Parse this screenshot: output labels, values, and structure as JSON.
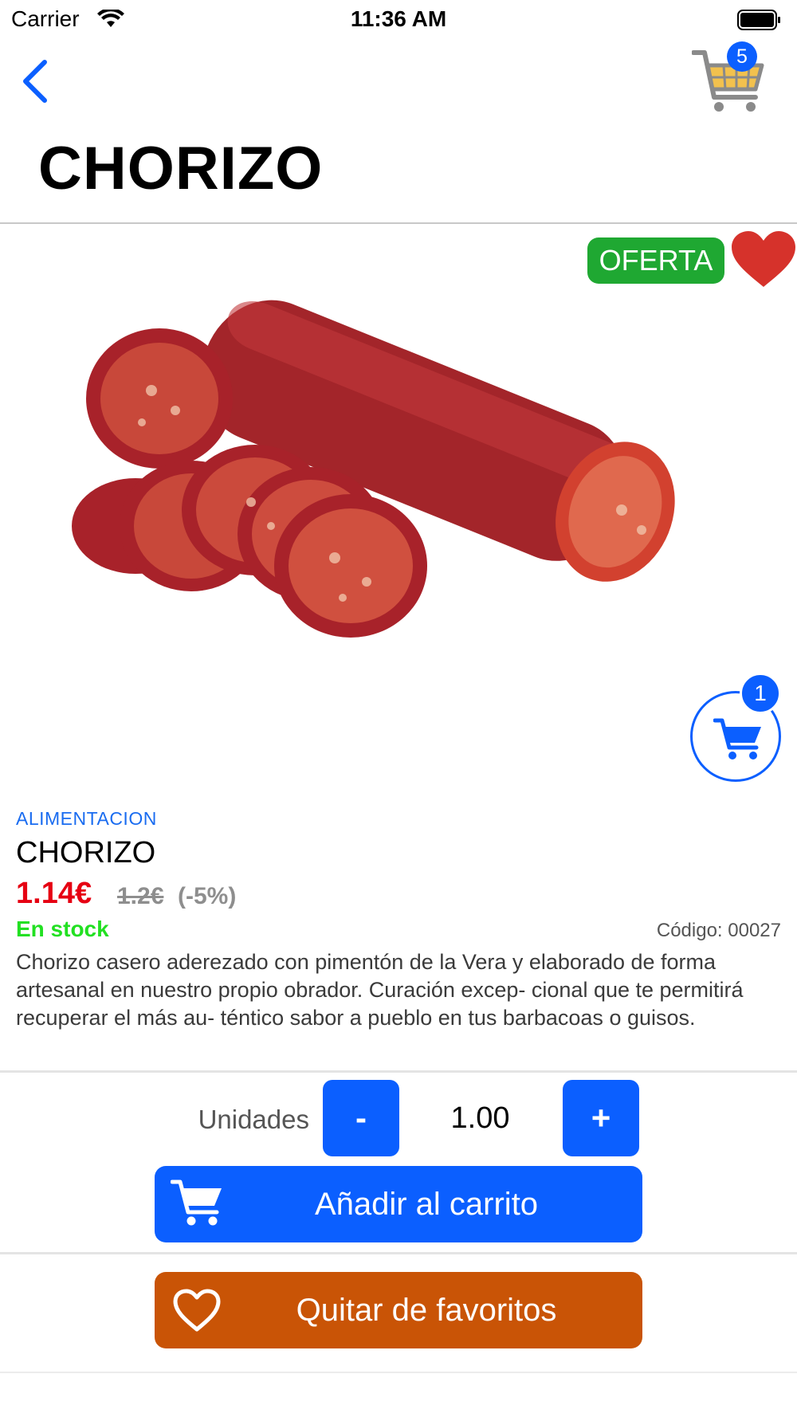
{
  "status_bar": {
    "carrier": "Carrier",
    "time": "11:36 AM",
    "wifi_icon": "wifi-icon",
    "battery_icon": "battery-icon"
  },
  "header": {
    "back_icon": "chevron-left-icon",
    "cart_icon": "shopping-cart-icon",
    "cart_count": "5",
    "title": "CHORIZO"
  },
  "product": {
    "image_alt": "chorizo-photo",
    "offer_badge": "OFERTA",
    "favorite_icon": "heart-filled-icon",
    "in_cart_count": "1",
    "category": "ALIMENTACION",
    "name": "CHORIZO",
    "price": "1.14€",
    "old_price": "1.2€",
    "discount": "(-5%)",
    "stock": "En stock",
    "code": "Código: 00027",
    "description": "Chorizo casero aderezado con pimentón de la Vera y elaborado de forma artesanal en nuestro propio obrador. Curación excep- cional que te permitirá recuperar el más au- téntico sabor a pueblo en tus barbacoas o guisos."
  },
  "quantity": {
    "label": "Unidades",
    "minus_label": "-",
    "value": "1.00",
    "plus_label": "+"
  },
  "actions": {
    "add_to_cart": "Añadir al carrito",
    "remove_favorite": "Quitar de favoritos"
  },
  "colors": {
    "accent": "#0b5fff",
    "price_red": "#e60012",
    "stock_green": "#22e022",
    "offer_green": "#1fa832",
    "favorite_orange": "#c95406",
    "heart_red": "#d6322b"
  }
}
